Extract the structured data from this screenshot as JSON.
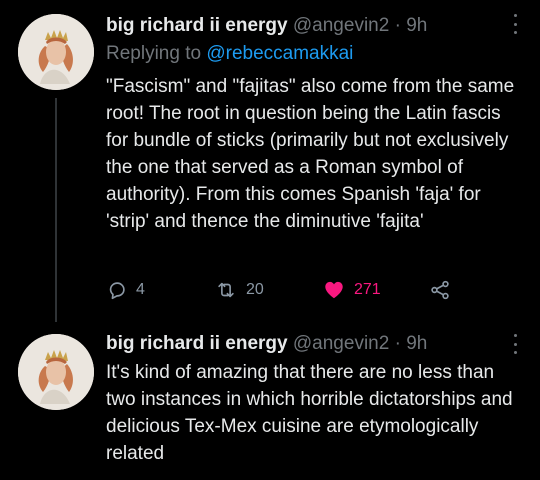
{
  "tweets": [
    {
      "author_name": "big richard ii energy",
      "handle": "@angevin2",
      "separator": "·",
      "time": "9h",
      "reply_prefix": "Replying to",
      "reply_to": "@rebeccamakkai",
      "text": "\"Fascism\" and \"fajitas\" also come from the same root! The root in question being the Latin fascis for bundle of sticks (primarily but not exclusively the one that served as a Roman symbol of authority). From this comes Spanish 'faja' for 'strip' and thence the diminutive 'fajita'",
      "replies": "4",
      "retweets": "20",
      "likes": "271"
    },
    {
      "author_name": "big richard ii energy",
      "handle": "@angevin2",
      "separator": "·",
      "time": "9h",
      "text": "It's kind of amazing that there are no less than two instances in which horrible dictatorships and delicious Tex-Mex cuisine are etymologically related"
    }
  ],
  "icons": {
    "reply": "reply-icon",
    "retweet": "retweet-icon",
    "like": "heart-icon",
    "share": "share-icon",
    "more": "more-icon"
  },
  "colors": {
    "background": "#000000",
    "text": "#e7e9ea",
    "muted": "#71767b",
    "link": "#1d9bf0",
    "like": "#f91880"
  }
}
